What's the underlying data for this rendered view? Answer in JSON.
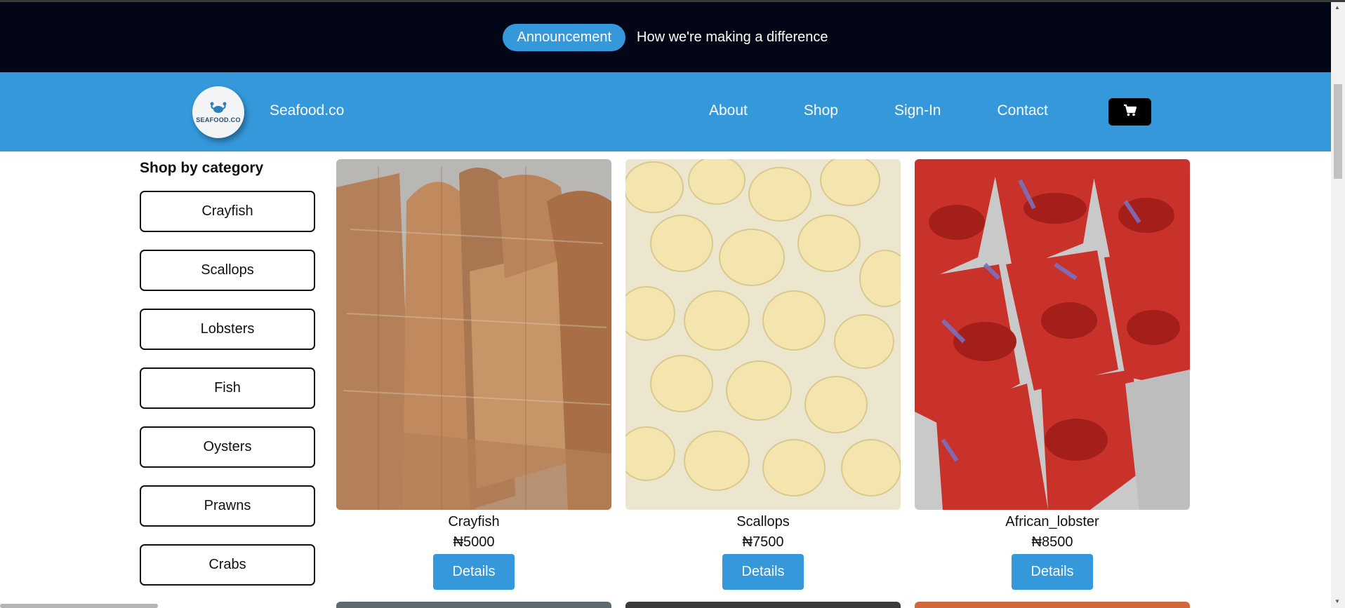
{
  "announcement": {
    "pill_label": "Announcement",
    "text": "How we're making a difference"
  },
  "nav": {
    "logo_text": "SEAFOOD.CO",
    "brand": "Seafood.co",
    "links": {
      "about": "About",
      "shop": "Shop",
      "signin": "Sign-In",
      "contact": "Contact"
    },
    "cart_icon": "cart-icon"
  },
  "sidebar": {
    "title": "Shop by category",
    "categories": [
      "Crayfish",
      "Scallops",
      "Lobsters",
      "Fish",
      "Oysters",
      "Prawns",
      "Crabs"
    ]
  },
  "products": [
    {
      "name": "Crayfish",
      "price": "₦5000",
      "button": "Details"
    },
    {
      "name": "Scallops",
      "price": "₦7500",
      "button": "Details"
    },
    {
      "name": "African_lobster",
      "price": "₦8500",
      "button": "Details"
    }
  ],
  "colors": {
    "announce_bg": "#030617",
    "accent": "#3498db",
    "cart_bg": "#000000"
  }
}
